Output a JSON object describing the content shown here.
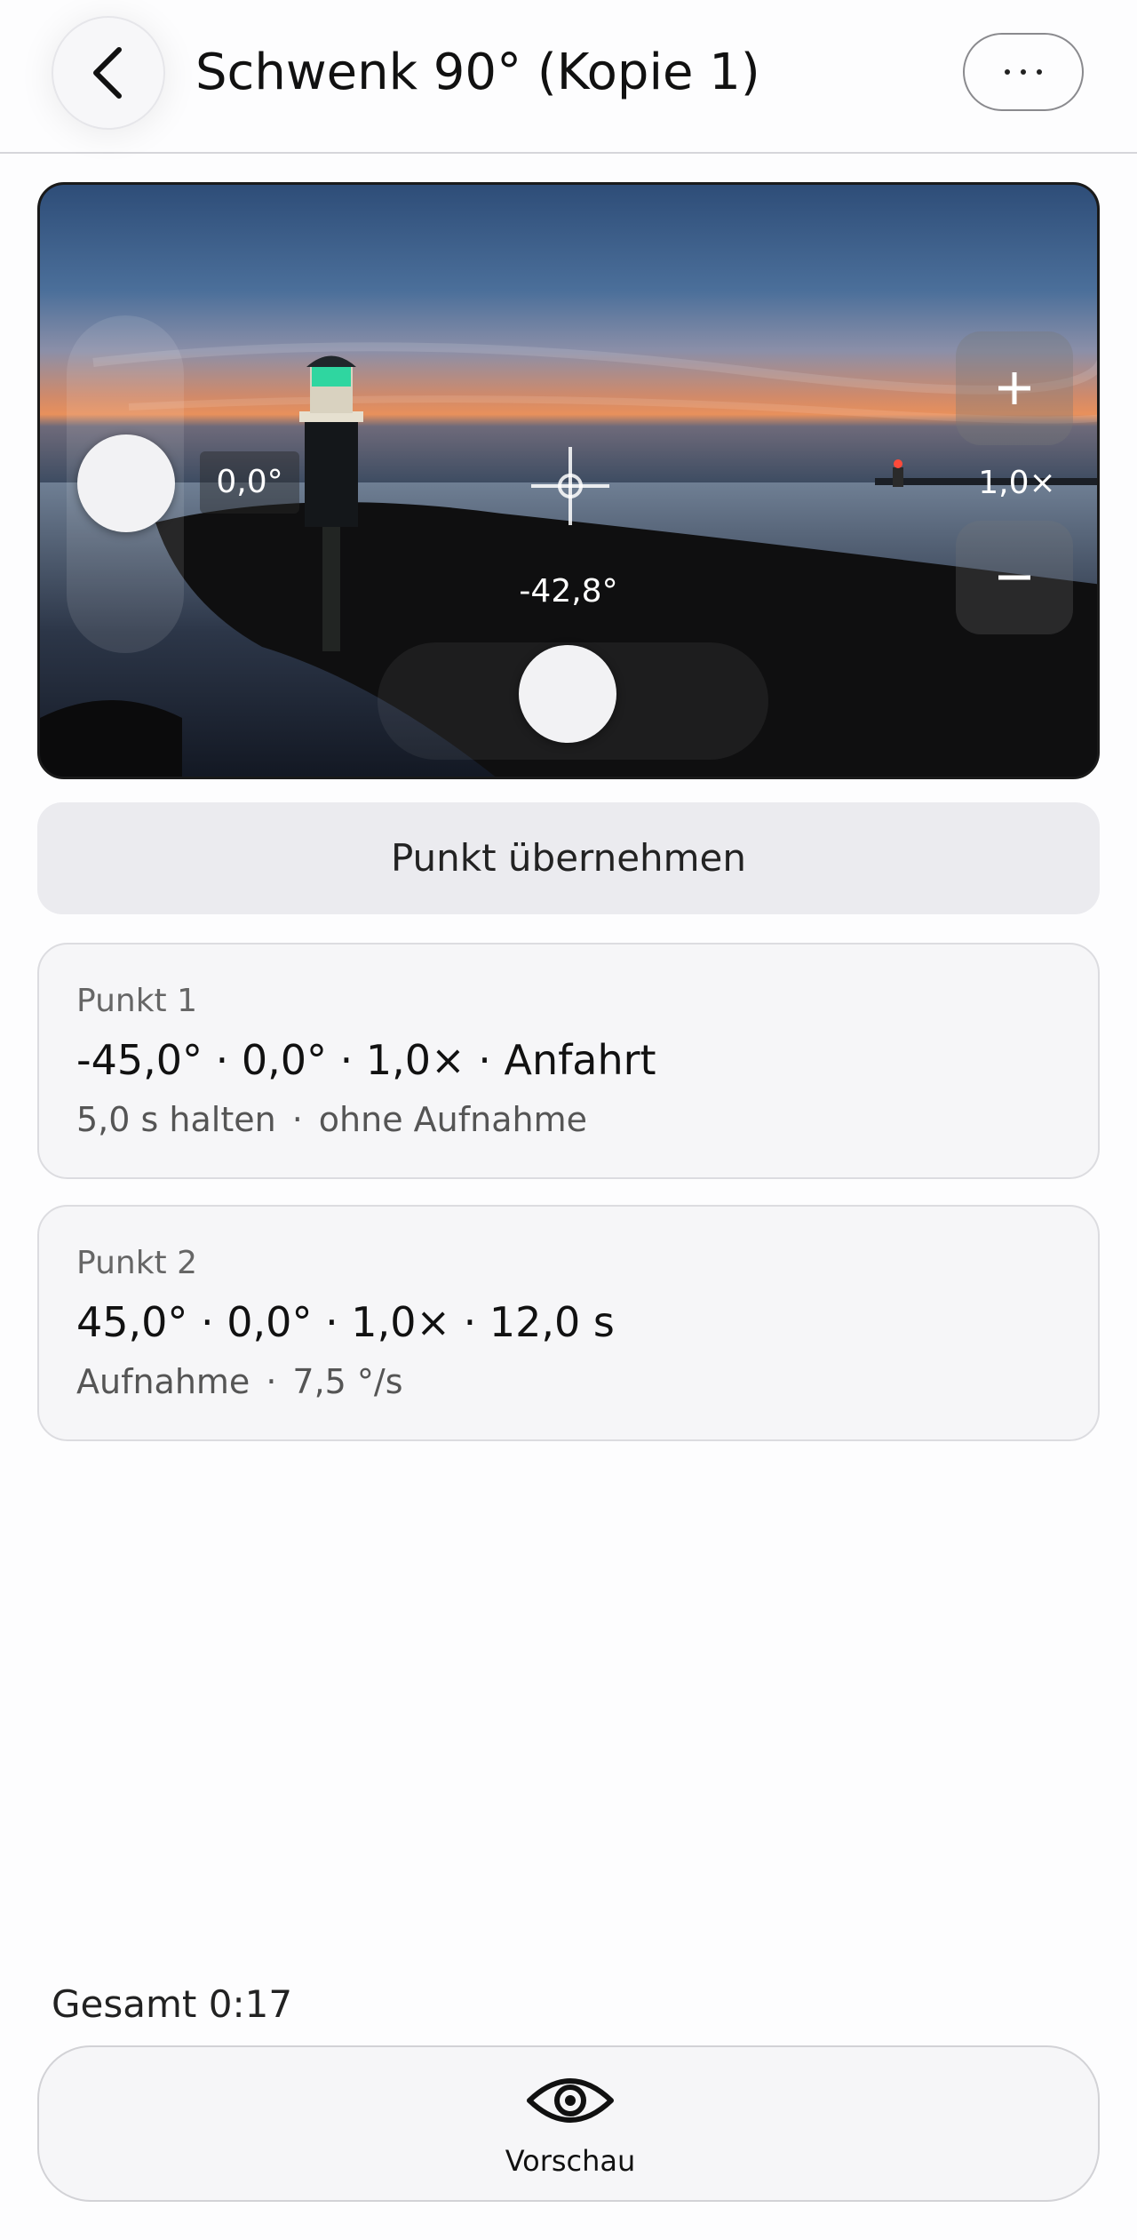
{
  "header": {
    "title": "Schwenk 90° (Kopie 1)",
    "back_icon": "chevron-left-icon",
    "more_icon": "ellipsis-icon"
  },
  "camera": {
    "tilt_value": "0,0°",
    "pan_value": "-42,8°",
    "zoom_value": "1,0×",
    "zoom_in_icon": "plus-icon",
    "zoom_out_icon": "minus-icon",
    "crosshair_icon": "crosshair-icon"
  },
  "apply_button": {
    "label": "Punkt übernehmen"
  },
  "points": [
    {
      "label": "Punkt 1",
      "main": "-45,0° · 0,0° · 1,0× · Anfahrt",
      "sub_a": "5,0 s halten",
      "sub_b": "ohne Aufnahme"
    },
    {
      "label": "Punkt 2",
      "main": "45,0° · 0,0° · 1,0× · 12,0 s",
      "sub_a": "Aufnahme",
      "sub_b": "7,5 °/s"
    }
  ],
  "sub_separator": "·",
  "footer": {
    "total": "Gesamt 0:17",
    "preview_label": "Vorschau",
    "preview_icon": "eye-icon"
  }
}
